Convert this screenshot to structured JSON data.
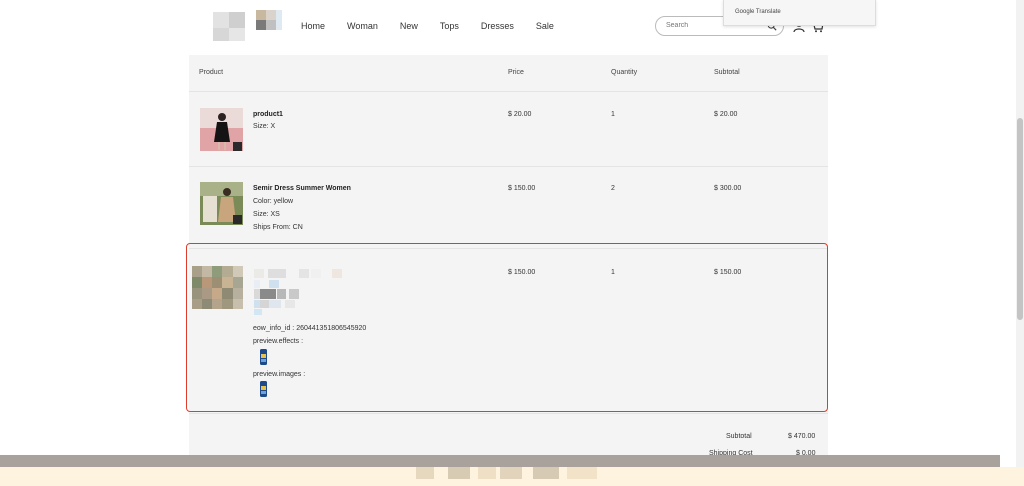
{
  "nav": {
    "items": [
      "Home",
      "Woman",
      "New",
      "Tops",
      "Dresses",
      "Sale"
    ]
  },
  "search": {
    "placeholder": "Search"
  },
  "translate_popup": {
    "label": "Google Translate"
  },
  "cart": {
    "headers": {
      "product": "Product",
      "price": "Price",
      "quantity": "Quantity",
      "subtotal": "Subtotal"
    },
    "items": [
      {
        "name": "product1",
        "attrs": [
          "Size: X"
        ],
        "price": "$ 20.00",
        "quantity": "1",
        "subtotal": "$ 20.00"
      },
      {
        "name": "Semir Dress Summer Women",
        "attrs": [
          "Color: yellow",
          "Size: XS",
          "Ships From: CN"
        ],
        "price": "$ 150.00",
        "quantity": "2",
        "subtotal": "$ 300.00"
      },
      {
        "name": "",
        "attrs": [
          "eow_info_id : 260441351806545920",
          "preview.effects :",
          "preview.images :"
        ],
        "price": "$ 150.00",
        "quantity": "1",
        "subtotal": "$ 150.00"
      }
    ],
    "summary": {
      "subtotal_label": "Subtotal",
      "subtotal_value": "$ 470.00",
      "shipping_label": "Shipping Cost",
      "shipping_value": "$ 0.00"
    }
  },
  "colors": {
    "selection_border": "#e23b2b",
    "cart_bg": "#f4f4f4",
    "bottom_bar": "#a9a29c"
  }
}
